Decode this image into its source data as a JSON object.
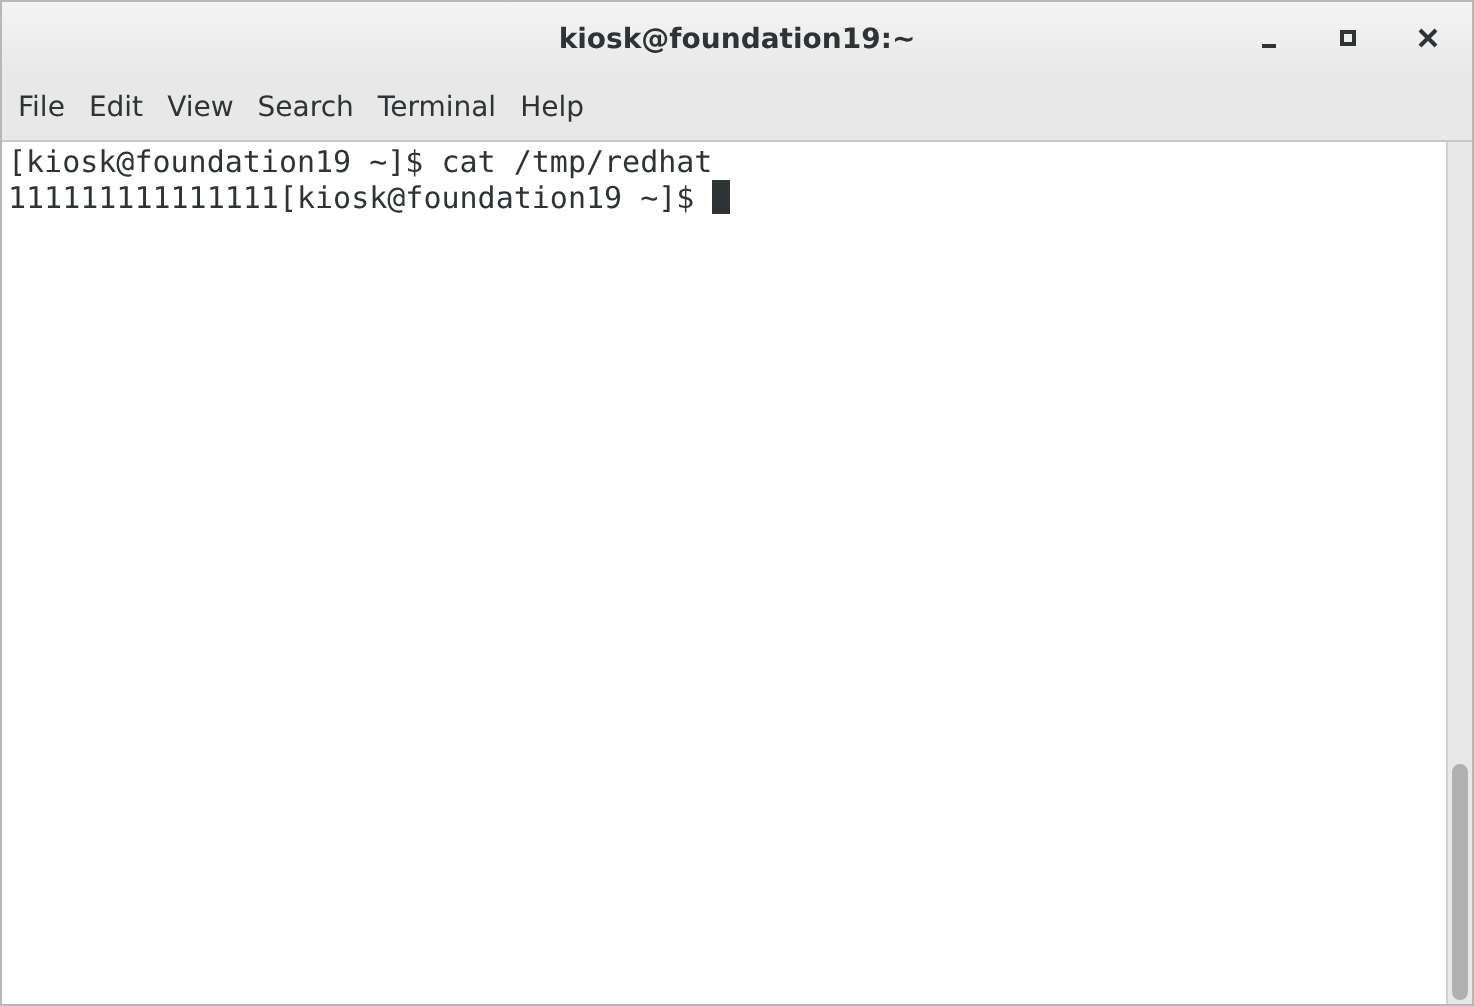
{
  "window": {
    "title": "kiosk@foundation19:~"
  },
  "menu": [
    "File",
    "Edit",
    "View",
    "Search",
    "Terminal",
    "Help"
  ],
  "terminal": {
    "lines": [
      "[kiosk@foundation19 ~]$ cat /tmp/redhat",
      "111111111111111[kiosk@foundation19 ~]$ "
    ],
    "cursor": true
  }
}
